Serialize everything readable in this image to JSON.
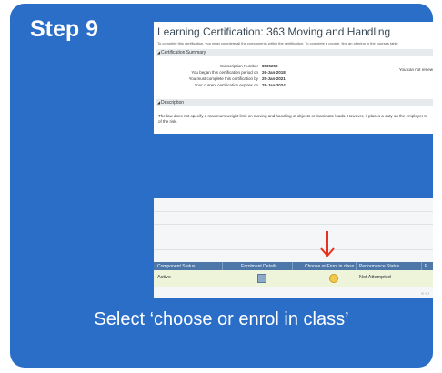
{
  "step": {
    "title": "Step 9"
  },
  "certification": {
    "title": "Learning Certification: 363 Moving and Handling",
    "intro": "To complete this certification, you must complete all the components within the certification. To complete a course, find an offering in the courses table",
    "summary_heading": "Certification Summary",
    "summary_rows": [
      {
        "label": "Subscription Number",
        "value": "8536253"
      },
      {
        "label": "You began this certification period on",
        "value": "26-Jan-2018"
      },
      {
        "label": "You must complete this certification by",
        "value": "25-Jan-2021"
      },
      {
        "label": "Your current certification expires on",
        "value": "25-Jan-2024"
      }
    ],
    "renew_note": "You can not renew",
    "description_heading": "Description",
    "description_text": "The law does not specify a maximum weight limit on moving and handling of objects or inanimate loads. However, it places a duty on the employer to of the risk."
  },
  "table": {
    "headers": [
      "Component Status",
      "Enrolment Details",
      "Choose or Enrol in class",
      "Performance Status",
      "P"
    ],
    "row": {
      "component_status": "Active",
      "performance_status": "Not Attempted"
    },
    "pager": "« ‹ ›"
  },
  "instruction": {
    "text": "Select ‘choose or enrol in class’"
  },
  "colors": {
    "card": "#2b6ec8",
    "table_header": "#4c77a8",
    "arrow": "#e8321e"
  }
}
